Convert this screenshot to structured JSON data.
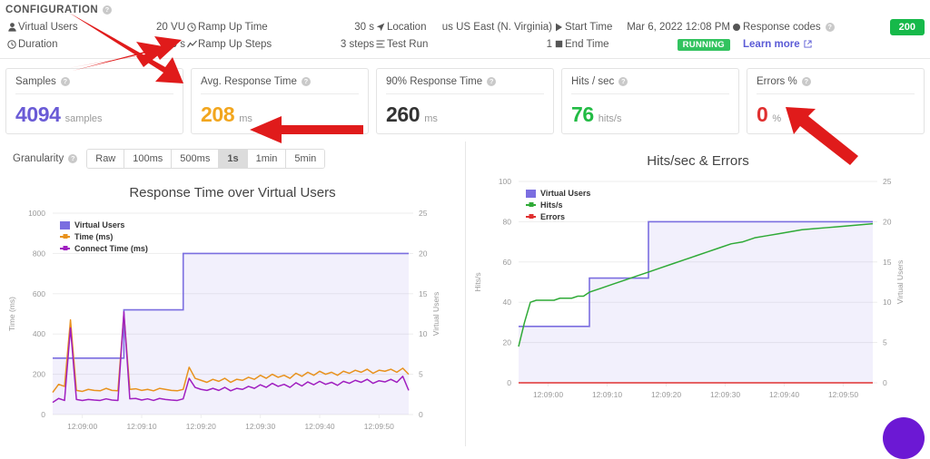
{
  "header": {
    "title": "CONFIGURATION",
    "help_icon": "help-icon",
    "rows": [
      {
        "icon": "user-icon",
        "label": "Virtual Users",
        "value": "20 VU"
      },
      {
        "icon": "clock-icon",
        "label": "Duration",
        "value": "60 s"
      },
      {
        "icon": "clock-icon",
        "label": "Ramp Up Time",
        "value": "30 s"
      },
      {
        "icon": "chart-line-icon",
        "label": "Ramp Up Steps",
        "value": "3 steps"
      },
      {
        "icon": "location-icon",
        "label": "Location",
        "value": "us US East (N. Virginia)"
      },
      {
        "icon": "list-icon",
        "label": "Test Run",
        "value": "1"
      },
      {
        "icon": "play-icon",
        "label": "Start Time",
        "value": "Mar 6, 2022 12:08 PM"
      },
      {
        "icon": "stop-icon",
        "label": "End Time",
        "value": "RUNNING"
      }
    ],
    "status_badge": "RUNNING",
    "response_codes_label": "Response codes",
    "learn_more": "Learn more",
    "response_code_badge": "200"
  },
  "cards": [
    {
      "title": "Samples",
      "value": "4094",
      "unit": "samples",
      "color": "#6a5bd6"
    },
    {
      "title": "Avg. Response Time",
      "value": "208",
      "unit": "ms",
      "color": "#f2a61e"
    },
    {
      "title": "90% Response Time",
      "value": "260",
      "unit": "ms",
      "color": "#333333"
    },
    {
      "title": "Hits / sec",
      "value": "76",
      "unit": "hits/s",
      "color": "#22bb44"
    },
    {
      "title": "Errors %",
      "value": "0",
      "unit": "%",
      "color": "#e03030"
    }
  ],
  "granularity": {
    "label": "Granularity",
    "options": [
      "Raw",
      "100ms",
      "500ms",
      "1s",
      "1min",
      "5min"
    ],
    "selected": "1s"
  },
  "chart_data": [
    {
      "type": "line",
      "title": "Response Time over Virtual Users",
      "xlabel": "",
      "ylabel": "Time (ms)",
      "y2label": "Virtual Users",
      "ylim": [
        0,
        1000
      ],
      "y2lim": [
        0,
        25
      ],
      "yticks": [
        0,
        200,
        400,
        600,
        800,
        1000
      ],
      "y2ticks": [
        0,
        5,
        10,
        15,
        20,
        25
      ],
      "xticks": [
        "12:09:00",
        "12:09:10",
        "12:09:20",
        "12:09:30",
        "12:09:40",
        "12:09:50"
      ],
      "grid": true,
      "legend_position": "top-left",
      "series": [
        {
          "name": "Virtual Users",
          "color": "#7b6ee0",
          "axis": "right",
          "kind": "area-step",
          "x": [
            0,
            2,
            11,
            12,
            19,
            20,
            22,
            48,
            49,
            52,
            60
          ],
          "values": [
            7,
            7,
            7,
            13,
            13,
            13,
            20,
            20,
            20,
            20,
            20
          ]
        },
        {
          "name": "Time (ms)",
          "color": "#e8921e",
          "axis": "left",
          "x": [
            0,
            1,
            2,
            3,
            4,
            5,
            6,
            7,
            8,
            9,
            10,
            11,
            12,
            13,
            14,
            15,
            16,
            17,
            18,
            19,
            20,
            21,
            22,
            23,
            24,
            25,
            26,
            27,
            28,
            29,
            30,
            31,
            32,
            33,
            34,
            35,
            36,
            37,
            38,
            39,
            40,
            41,
            42,
            43,
            44,
            45,
            46,
            47,
            48,
            49,
            50,
            51,
            52,
            53,
            54,
            55,
            56,
            57,
            58,
            59,
            60
          ],
          "values": [
            110,
            150,
            140,
            470,
            120,
            115,
            125,
            120,
            118,
            130,
            120,
            118,
            500,
            125,
            128,
            120,
            125,
            118,
            130,
            125,
            120,
            118,
            125,
            235,
            180,
            170,
            160,
            175,
            165,
            180,
            160,
            175,
            170,
            185,
            175,
            195,
            180,
            200,
            185,
            195,
            180,
            205,
            190,
            210,
            195,
            215,
            200,
            210,
            195,
            215,
            205,
            220,
            210,
            225,
            205,
            220,
            215,
            225,
            210,
            230,
            200
          ]
        },
        {
          "name": "Connect Time (ms)",
          "color": "#a01fc0",
          "axis": "left",
          "x": [
            0,
            1,
            2,
            3,
            4,
            5,
            6,
            7,
            8,
            9,
            10,
            11,
            12,
            13,
            14,
            15,
            16,
            17,
            18,
            19,
            20,
            21,
            22,
            23,
            24,
            25,
            26,
            27,
            28,
            29,
            30,
            31,
            32,
            33,
            34,
            35,
            36,
            37,
            38,
            39,
            40,
            41,
            42,
            43,
            44,
            45,
            46,
            47,
            48,
            49,
            50,
            51,
            52,
            53,
            54,
            55,
            56,
            57,
            58,
            59,
            60
          ],
          "values": [
            60,
            80,
            70,
            430,
            75,
            70,
            75,
            72,
            70,
            78,
            72,
            70,
            510,
            78,
            80,
            72,
            78,
            70,
            80,
            75,
            72,
            70,
            78,
            180,
            135,
            125,
            120,
            130,
            120,
            135,
            118,
            130,
            125,
            140,
            130,
            148,
            135,
            155,
            140,
            150,
            135,
            158,
            142,
            162,
            148,
            165,
            150,
            160,
            145,
            165,
            155,
            170,
            160,
            175,
            155,
            168,
            162,
            175,
            160,
            190,
            120
          ]
        }
      ]
    },
    {
      "type": "line",
      "title": "Hits/sec & Errors",
      "xlabel": "",
      "ylabel": "Hits/s",
      "y2label": "Virtual Users",
      "ylim": [
        0,
        100
      ],
      "y2lim": [
        0,
        25
      ],
      "yticks": [
        0,
        20,
        40,
        60,
        80,
        100
      ],
      "y2ticks": [
        0,
        5,
        10,
        15,
        20,
        25
      ],
      "xticks": [
        "12:09:00",
        "12:09:10",
        "12:09:20",
        "12:09:30",
        "12:09:40",
        "12:09:50"
      ],
      "grid": true,
      "legend_position": "top-left",
      "series": [
        {
          "name": "Virtual Users",
          "color": "#7b6ee0",
          "axis": "right",
          "kind": "area-step",
          "x": [
            0,
            2,
            11,
            12,
            19,
            20,
            22,
            48,
            49,
            52,
            60
          ],
          "values": [
            7,
            7,
            7,
            13,
            13,
            13,
            20,
            20,
            20,
            20,
            20
          ]
        },
        {
          "name": "Hits/s",
          "color": "#2faa37",
          "axis": "left",
          "x": [
            0,
            1,
            2,
            3,
            4,
            5,
            6,
            7,
            8,
            9,
            10,
            11,
            12,
            14,
            16,
            18,
            20,
            22,
            24,
            26,
            28,
            30,
            32,
            34,
            36,
            38,
            40,
            42,
            44,
            46,
            48,
            50,
            52,
            54,
            56,
            58,
            60
          ],
          "values": [
            18,
            30,
            40,
            41,
            41,
            41,
            41,
            42,
            42,
            42,
            43,
            43,
            45,
            47,
            49,
            51,
            53,
            55,
            57,
            59,
            61,
            63,
            65,
            67,
            69,
            70,
            72,
            73,
            74,
            75,
            76,
            76.5,
            77,
            77.5,
            78,
            78.5,
            79
          ]
        },
        {
          "name": "Errors",
          "color": "#e03030",
          "axis": "left",
          "x": [
            0,
            60
          ],
          "values": [
            0,
            0
          ]
        }
      ]
    }
  ]
}
